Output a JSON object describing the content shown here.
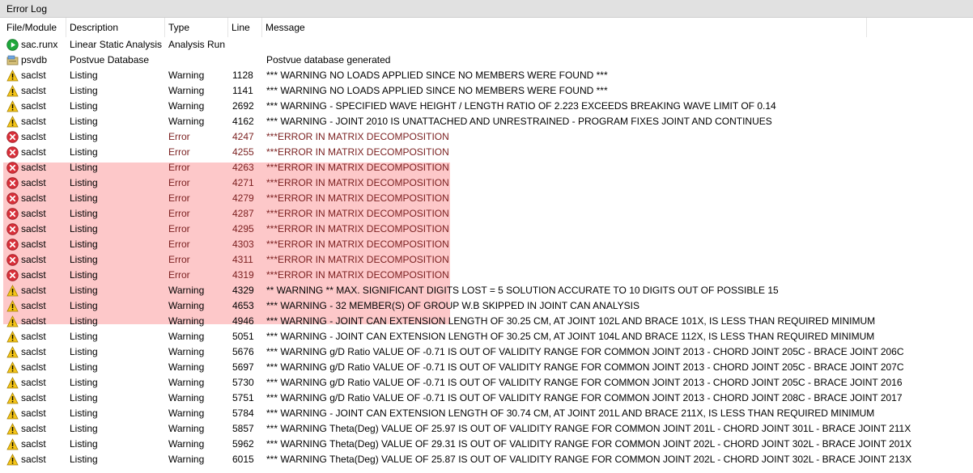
{
  "window": {
    "title": "Error Log"
  },
  "columns": {
    "file": "File/Module",
    "description": "Description",
    "type": "Type",
    "line": "Line",
    "message": "Message"
  },
  "rows": [
    {
      "icon": "run",
      "file": "sac.runx",
      "description": "Linear Static Analysis",
      "type": "Analysis Run",
      "line": "",
      "message": "",
      "error": false
    },
    {
      "icon": "db",
      "file": "psvdb",
      "description": "Postvue Database",
      "type": "",
      "line": "",
      "message": "Postvue database generated",
      "error": false
    },
    {
      "icon": "warning",
      "file": "saclst",
      "description": "Listing",
      "type": "Warning",
      "line": "1128",
      "message": "*** WARNING NO LOADS APPLIED SINCE NO MEMBERS WERE FOUND ***",
      "error": false
    },
    {
      "icon": "warning",
      "file": "saclst",
      "description": "Listing",
      "type": "Warning",
      "line": "1141",
      "message": "*** WARNING NO LOADS APPLIED SINCE NO MEMBERS WERE FOUND ***",
      "error": false
    },
    {
      "icon": "warning",
      "file": "saclst",
      "description": "Listing",
      "type": "Warning",
      "line": "2692",
      "message": "*** WARNING - SPECIFIED WAVE HEIGHT / LENGTH RATIO OF    2.223 EXCEEDS BREAKING WAVE LIMIT OF 0.14",
      "error": false
    },
    {
      "icon": "warning",
      "file": "saclst",
      "description": "Listing",
      "type": "Warning",
      "line": "4162",
      "message": "*** WARNING - JOINT 2010 IS UNATTACHED AND UNRESTRAINED - PROGRAM FIXES JOINT AND CONTINUES",
      "error": false
    },
    {
      "icon": "error",
      "file": "saclst",
      "description": "Listing",
      "type": "Error",
      "line": "4247",
      "message": "***ERROR IN MATRIX DECOMPOSITION",
      "error": true
    },
    {
      "icon": "error",
      "file": "saclst",
      "description": "Listing",
      "type": "Error",
      "line": "4255",
      "message": "***ERROR IN MATRIX DECOMPOSITION",
      "error": true
    },
    {
      "icon": "error",
      "file": "saclst",
      "description": "Listing",
      "type": "Error",
      "line": "4263",
      "message": "***ERROR IN MATRIX DECOMPOSITION",
      "error": true
    },
    {
      "icon": "error",
      "file": "saclst",
      "description": "Listing",
      "type": "Error",
      "line": "4271",
      "message": "***ERROR IN MATRIX DECOMPOSITION",
      "error": true
    },
    {
      "icon": "error",
      "file": "saclst",
      "description": "Listing",
      "type": "Error",
      "line": "4279",
      "message": "***ERROR IN MATRIX DECOMPOSITION",
      "error": true
    },
    {
      "icon": "error",
      "file": "saclst",
      "description": "Listing",
      "type": "Error",
      "line": "4287",
      "message": "***ERROR IN MATRIX DECOMPOSITION",
      "error": true
    },
    {
      "icon": "error",
      "file": "saclst",
      "description": "Listing",
      "type": "Error",
      "line": "4295",
      "message": "***ERROR IN MATRIX DECOMPOSITION",
      "error": true
    },
    {
      "icon": "error",
      "file": "saclst",
      "description": "Listing",
      "type": "Error",
      "line": "4303",
      "message": "***ERROR IN MATRIX DECOMPOSITION",
      "error": true
    },
    {
      "icon": "error",
      "file": "saclst",
      "description": "Listing",
      "type": "Error",
      "line": "4311",
      "message": "***ERROR IN MATRIX DECOMPOSITION",
      "error": true
    },
    {
      "icon": "error",
      "file": "saclst",
      "description": "Listing",
      "type": "Error",
      "line": "4319",
      "message": "***ERROR IN MATRIX DECOMPOSITION",
      "error": true
    },
    {
      "icon": "warning",
      "file": "saclst",
      "description": "Listing",
      "type": "Warning",
      "line": "4329",
      "message": "** WARNING ** MAX. SIGNIFICANT DIGITS LOST =   5      SOLUTION ACCURATE TO 10 DIGITS OUT OF POSSIBLE 15",
      "error": false
    },
    {
      "icon": "warning",
      "file": "saclst",
      "description": "Listing",
      "type": "Warning",
      "line": "4653",
      "message": "*** WARNING -    32 MEMBER(S) OF GROUP W.B  SKIPPED IN JOINT CAN ANALYSIS",
      "error": false
    },
    {
      "icon": "warning",
      "file": "saclst",
      "description": "Listing",
      "type": "Warning",
      "line": "4946",
      "message": "*** WARNING - JOINT CAN EXTENSION LENGTH OF  30.25 CM, AT JOINT 102L AND BRACE 101X, IS LESS THAN REQUIRED MINIMUM",
      "error": false
    },
    {
      "icon": "warning",
      "file": "saclst",
      "description": "Listing",
      "type": "Warning",
      "line": "5051",
      "message": "*** WARNING - JOINT CAN EXTENSION LENGTH OF  30.25 CM, AT JOINT 104L AND BRACE 112X, IS LESS THAN REQUIRED MINIMUM",
      "error": false
    },
    {
      "icon": "warning",
      "file": "saclst",
      "description": "Listing",
      "type": "Warning",
      "line": "5676",
      "message": "*** WARNING g/D Ratio VALUE OF -0.71 IS OUT OF VALIDITY RANGE FOR COMMON JOINT 2013 - CHORD JOINT 205C - BRACE JOINT 206C",
      "error": false
    },
    {
      "icon": "warning",
      "file": "saclst",
      "description": "Listing",
      "type": "Warning",
      "line": "5697",
      "message": "*** WARNING g/D Ratio VALUE OF -0.71 IS OUT OF VALIDITY RANGE FOR COMMON JOINT 2013 - CHORD JOINT 205C - BRACE JOINT 207C",
      "error": false
    },
    {
      "icon": "warning",
      "file": "saclst",
      "description": "Listing",
      "type": "Warning",
      "line": "5730",
      "message": "*** WARNING g/D Ratio VALUE OF -0.71 IS OUT OF VALIDITY RANGE FOR COMMON JOINT 2013 - CHORD JOINT 205C - BRACE JOINT 2016",
      "error": false
    },
    {
      "icon": "warning",
      "file": "saclst",
      "description": "Listing",
      "type": "Warning",
      "line": "5751",
      "message": "*** WARNING g/D Ratio VALUE OF -0.71 IS OUT OF VALIDITY RANGE FOR COMMON JOINT 2013 - CHORD JOINT 208C - BRACE JOINT 2017",
      "error": false
    },
    {
      "icon": "warning",
      "file": "saclst",
      "description": "Listing",
      "type": "Warning",
      "line": "5784",
      "message": "*** WARNING - JOINT CAN EXTENSION LENGTH OF  30.74 CM, AT JOINT 201L AND BRACE 211X, IS LESS THAN REQUIRED MINIMUM",
      "error": false
    },
    {
      "icon": "warning",
      "file": "saclst",
      "description": "Listing",
      "type": "Warning",
      "line": "5857",
      "message": "*** WARNING Theta(Deg) VALUE OF 25.97 IS OUT OF VALIDITY RANGE FOR COMMON JOINT 201L - CHORD JOINT 301L - BRACE JOINT 211X",
      "error": false
    },
    {
      "icon": "warning",
      "file": "saclst",
      "description": "Listing",
      "type": "Warning",
      "line": "5962",
      "message": "*** WARNING Theta(Deg) VALUE OF 29.31 IS OUT OF VALIDITY RANGE FOR COMMON JOINT 202L - CHORD JOINT 302L - BRACE JOINT 201X",
      "error": false
    },
    {
      "icon": "warning",
      "file": "saclst",
      "description": "Listing",
      "type": "Warning",
      "line": "6015",
      "message": "*** WARNING Theta(Deg) VALUE OF 25.87 IS OUT OF VALIDITY RANGE FOR COMMON JOINT 202L - CHORD JOINT 302L - BRACE JOINT 213X",
      "error": false
    }
  ],
  "colors": {
    "error_highlight": "#fdc8c9",
    "warning": "#f5c518",
    "error": "#d9303a",
    "run": "#1ea83b"
  }
}
